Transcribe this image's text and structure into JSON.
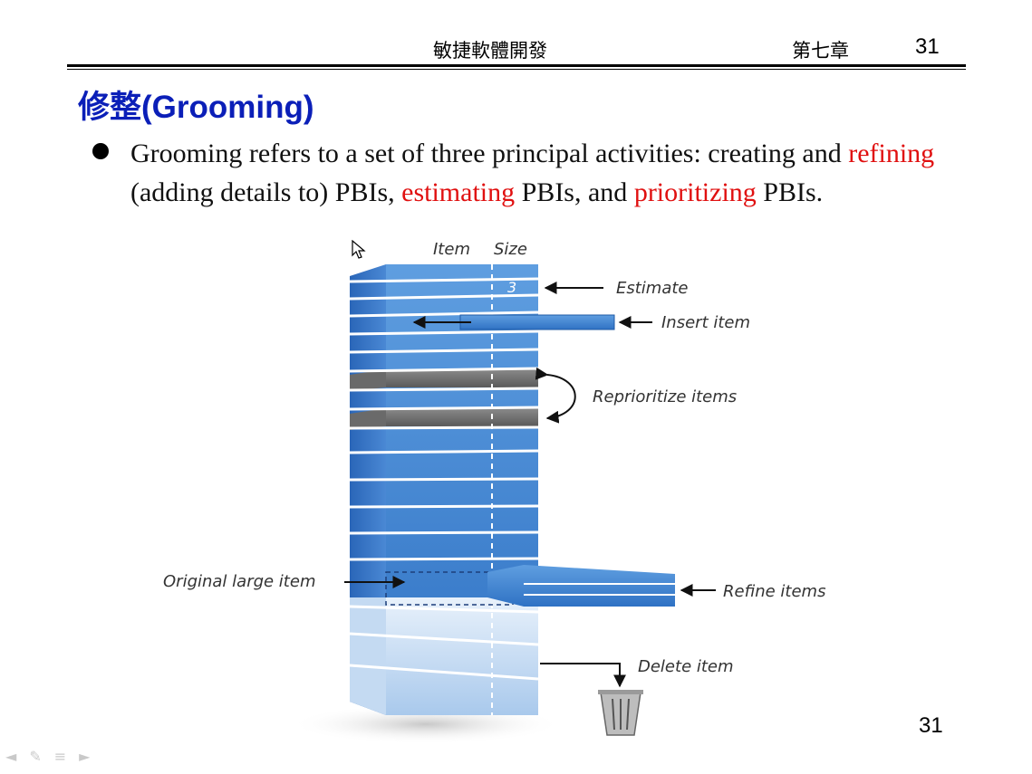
{
  "header": {
    "course": "敏捷軟體開發",
    "chapter": "第七章",
    "slide_number": "31"
  },
  "title": "修整(Grooming)",
  "bullet": {
    "t1": "Grooming refers to a set of three principal activities: creating and ",
    "r1": "refining",
    "t2": " (adding details to) PBIs, ",
    "r2": "estimating",
    "t3": " PBIs, and ",
    "r3": "prioritizing",
    "t4": " PBIs."
  },
  "figure": {
    "col_item": "Item",
    "col_size": "Size",
    "size_value": "3",
    "labels": {
      "estimate": "Estimate",
      "insert": "Insert item",
      "reprioritize": "Reprioritize items",
      "original": "Original large item",
      "refine": "Refine items",
      "delete": "Delete item"
    }
  },
  "footer_page": "31",
  "nav_icons": [
    "prev-icon",
    "pen-icon",
    "menu-icon",
    "next-icon"
  ],
  "colors": {
    "title": "#0b1fb8",
    "highlight": "#e01010",
    "stack_blue": "#3a7fd0",
    "stack_gray": "#6e6e6e"
  }
}
